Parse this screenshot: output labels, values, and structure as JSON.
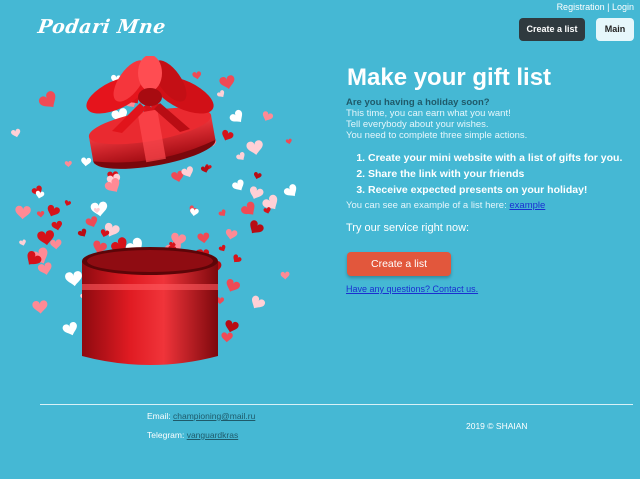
{
  "header": {
    "logo": "Podari Mne",
    "registration": "Registration",
    "separator": "|",
    "login": "Login",
    "create_list": "Create a list",
    "main": "Main"
  },
  "hero": {
    "title": "Make your gift list",
    "question": "Are you having a holiday soon?",
    "lines": [
      "This time, you can earn what you want!",
      "Tell everybody about your wishes.",
      "You need to complete three simple actions."
    ],
    "steps": [
      "Create your mini website with a list of gifts for you.",
      "Share the link with your friends",
      "Receive expected presents on your holiday!"
    ],
    "example_text": "You can see an example of a list here: ",
    "example_link": "example",
    "try_text": "Try our service right now:",
    "cta": "Create a list",
    "contact_link": "Have any questions? Contact us."
  },
  "footer": {
    "email_label": "Email: ",
    "email": "championing@mail.ru",
    "telegram_label": "Telegram: ",
    "telegram": "vanguardkras",
    "copyright": "2019 © SHAIAN"
  },
  "colors": {
    "background": "#45b8d4",
    "dark_button": "#2f3a3f",
    "cta": "#e2573c",
    "gift_red": "#d6121a"
  },
  "icons": [
    "gift-box-illustration"
  ]
}
